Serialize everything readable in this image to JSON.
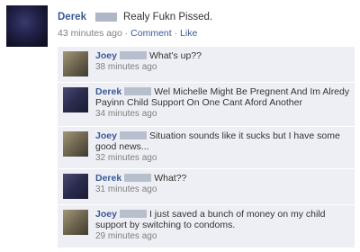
{
  "status": {
    "author": "Derek",
    "text": "Realy Fukn Pissed.",
    "time": "43 minutes ago",
    "comment_link": "Comment",
    "like_link": "Like",
    "separator": "·"
  },
  "comments": [
    {
      "author": "Joey",
      "text": "What's up??",
      "time": "38 minutes ago"
    },
    {
      "author": "Derek",
      "text": "Wel Michelle Might Be Pregnent And Im Alredy Payinn Child Support On One Cant Aford Another",
      "time": "34 minutes ago"
    },
    {
      "author": "Joey",
      "text": "Situation sounds like it sucks but I have some good news...",
      "time": "32 minutes ago"
    },
    {
      "author": "Derek",
      "text": "What??",
      "time": "31 minutes ago"
    },
    {
      "author": "Joey",
      "text": "I just saved a bunch of money on my child support by switching to condoms.",
      "time": "29 minutes ago"
    }
  ]
}
